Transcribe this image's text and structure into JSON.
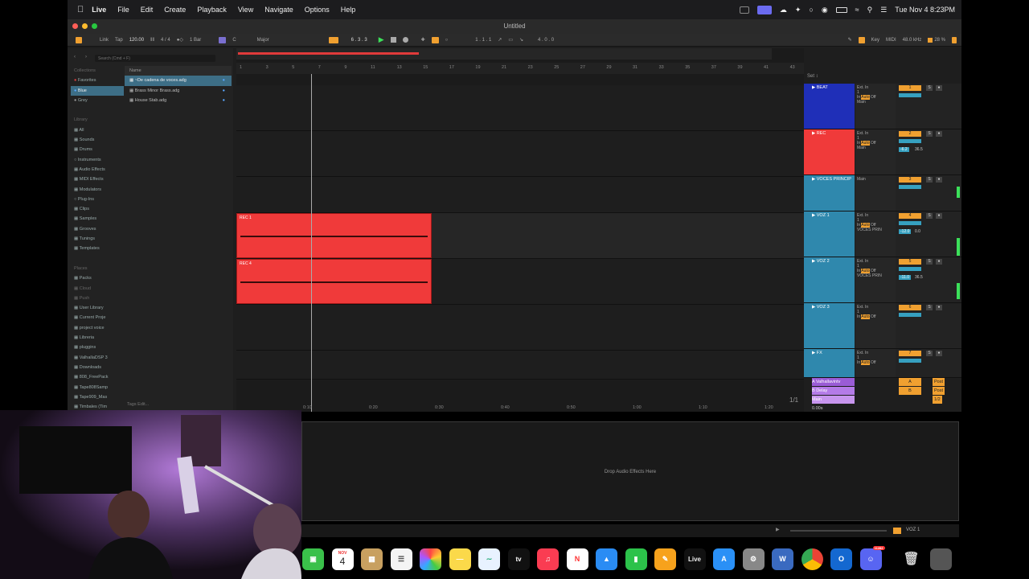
{
  "menubar": {
    "items": [
      "Live",
      "File",
      "Edit",
      "Create",
      "Playback",
      "View",
      "Navigate",
      "Options",
      "Help"
    ],
    "clock": "Tue Nov 4  8:23PM"
  },
  "window": {
    "title": "Untitled"
  },
  "transport": {
    "link": "Link",
    "tap": "Tap",
    "tempo": "120.00",
    "time_sig": "4 / 4",
    "quantize": "1 Bar",
    "key": "C",
    "scale": "Major",
    "position": "6 . 3 . 3",
    "loop_start": "1 . 1 . 1",
    "loop_length": "4 . 0 . 0",
    "key_label": "Key",
    "midi_label": "MIDI",
    "sample_rate": "48.0 kHz",
    "cpu": "28 %"
  },
  "browser": {
    "search_placeholder": "Search (Cmd + F)",
    "collections_header": "Collections",
    "collections": [
      "Favorites",
      "Blue",
      "Grey"
    ],
    "library_header": "Library",
    "library": [
      "All",
      "Sounds",
      "Drums",
      "Instruments",
      "Audio Effects",
      "MIDI Effects",
      "Modulators",
      "Plug-Ins",
      "Clips",
      "Samples",
      "Grooves",
      "Tunings",
      "Templates"
    ],
    "places_header": "Places",
    "places": [
      "Packs",
      "Cloud",
      "Push",
      "User Library",
      "Current Proje",
      "project voice",
      "Libreria",
      "pluggins",
      "ValhallaDSP 3",
      "Downloads",
      "808_FreePack",
      "Tape808Samp",
      "Tape909_Mas",
      "Timbales (Tim"
    ],
    "files_header": "Name",
    "files": [
      "~De cadena de voces.adg",
      "Brass Minor Brass.adg",
      "House Stab.adg"
    ],
    "tags": "Tags   Edit..."
  },
  "ruler": [
    "1",
    "3",
    "5",
    "7",
    "9",
    "11",
    "13",
    "15",
    "17",
    "19",
    "21",
    "23",
    "25",
    "27",
    "29",
    "31",
    "33",
    "35",
    "37",
    "39",
    "41",
    "43"
  ],
  "time_axis": [
    "0:10",
    "0:20",
    "0:30",
    "0:40",
    "0:50",
    "1:00",
    "1:10",
    "1:20"
  ],
  "tracks": [
    {
      "name": "BEAT",
      "color": "#1f2fb8",
      "input": "Ext. In",
      "channel": "1",
      "monitor": [
        "In",
        "Auto",
        "Off"
      ],
      "output": "Main",
      "number": "1"
    },
    {
      "name": "REC",
      "color": "#f03a3a",
      "input": "Ext. In",
      "channel": "1",
      "monitor": [
        "In",
        "Auto",
        "Off"
      ],
      "output": "Main",
      "number": "2",
      "vol": "-6.2",
      "pan": "36.5"
    },
    {
      "name": "VOCES PRINCIP",
      "color": "#2f88ad",
      "input": "Main",
      "output": "",
      "number": "3"
    },
    {
      "name": "VOZ 1",
      "color": "#2f88ad",
      "input": "Ext. In",
      "channel": "1",
      "monitor": [
        "In",
        "Auto",
        "Off"
      ],
      "output": "VOCES PRIN",
      "number": "4",
      "vol": "-12.0",
      "pan": "0.0"
    },
    {
      "name": "VOZ 2",
      "color": "#2f88ad",
      "input": "Ext. In",
      "channel": "1",
      "monitor": [
        "In",
        "Auto",
        "Off"
      ],
      "output": "VOCES PRIN",
      "number": "5",
      "vol": "-11.0",
      "pan": "36.5"
    },
    {
      "name": "VOZ 3",
      "color": "#2f88ad",
      "input": "Ext. In",
      "channel": "1",
      "monitor": [
        "In",
        "Auto",
        "Off"
      ],
      "output": "",
      "number": "6"
    },
    {
      "name": "FX",
      "color": "#2f88ad",
      "input": "Ext. In",
      "channel": "1",
      "monitor": [
        "In",
        "Auto",
        "Off"
      ],
      "output": "",
      "number": "7"
    }
  ],
  "returns": [
    {
      "name": "A Valhallavintv",
      "color": "#9a5cd6",
      "letter": "A",
      "mode": "Post"
    },
    {
      "name": "B Delay",
      "color": "#b47be8",
      "letter": "B",
      "mode": "Post"
    },
    {
      "name": "Main",
      "color": "#c795ee",
      "letter": "",
      "mode": "1/2"
    }
  ],
  "clips": [
    {
      "label": "REC 1",
      "track": "VOZ 1"
    },
    {
      "label": "REC 4",
      "track": "VOZ 2"
    }
  ],
  "zoom": "1/1",
  "latency": "0.00s",
  "drop_hint": "Drop Audio Effects Here",
  "status_track": "VOZ 1",
  "dock": {
    "calendar_month": "NOV",
    "calendar_day": "4",
    "live_label": "Live",
    "discord_badge": "11282"
  }
}
